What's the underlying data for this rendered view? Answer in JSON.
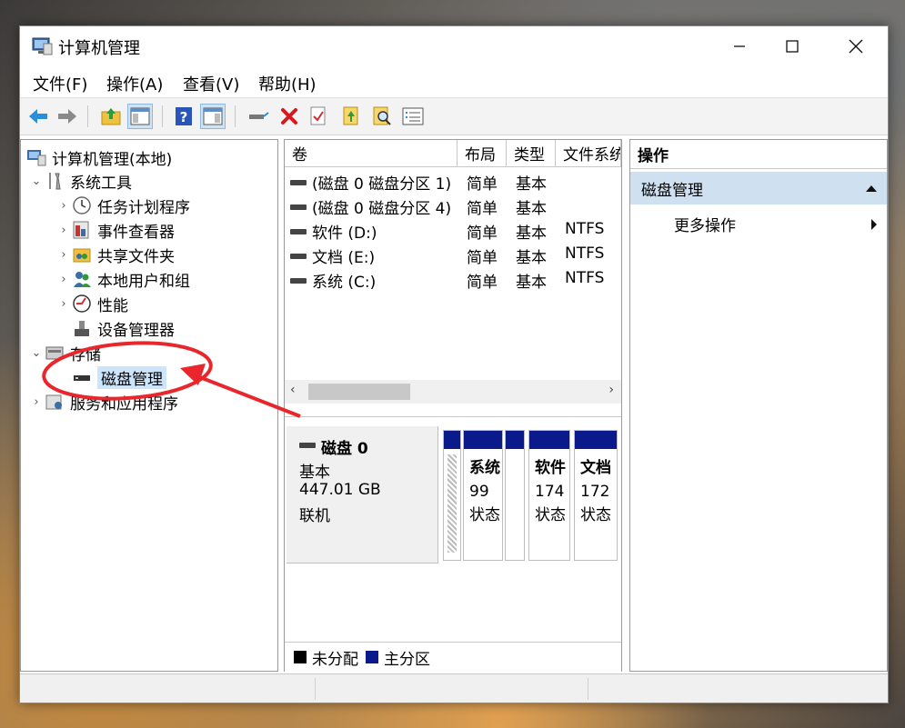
{
  "window": {
    "title": "计算机管理",
    "minimize_icon": "minimize-icon",
    "maximize_icon": "maximize-icon",
    "close_icon": "close-icon"
  },
  "menu": [
    {
      "label": "文件(F)"
    },
    {
      "label": "操作(A)"
    },
    {
      "label": "查看(V)"
    },
    {
      "label": "帮助(H)"
    }
  ],
  "toolbar": [
    "back-arrow-icon",
    "forward-arrow-icon",
    "up-folder-icon",
    "show-tree-icon",
    "help-icon",
    "action-pane-icon",
    "connect-drive-icon",
    "delete-icon",
    "check-icon",
    "import-icon",
    "search-icon",
    "properties-icon"
  ],
  "tree": {
    "root": "计算机管理(本地)",
    "system_tools": "系统工具",
    "task_scheduler": "任务计划程序",
    "event_viewer": "事件查看器",
    "shared_folders": "共享文件夹",
    "local_users": "本地用户和组",
    "performance": "性能",
    "device_manager": "设备管理器",
    "storage": "存储",
    "disk_management": "磁盘管理",
    "services_apps": "服务和应用程序"
  },
  "volume_table": {
    "headers": [
      "卷",
      "布局",
      "类型",
      "文件系统"
    ],
    "rows": [
      {
        "volume": "(磁盘 0 磁盘分区 1)",
        "layout": "简单",
        "type": "基本",
        "fs": ""
      },
      {
        "volume": "(磁盘 0 磁盘分区 4)",
        "layout": "简单",
        "type": "基本",
        "fs": ""
      },
      {
        "volume": "软件 (D:)",
        "layout": "简单",
        "type": "基本",
        "fs": "NTFS"
      },
      {
        "volume": "文档 (E:)",
        "layout": "简单",
        "type": "基本",
        "fs": "NTFS"
      },
      {
        "volume": "系统 (C:)",
        "layout": "简单",
        "type": "基本",
        "fs": "NTFS"
      }
    ]
  },
  "disk": {
    "name": "磁盘 0",
    "type": "基本",
    "size": "447.01 GB",
    "status": "联机",
    "partitions": [
      {
        "name": "系统",
        "size": "99",
        "status": "状态"
      },
      {
        "name": "软件",
        "size": "174",
        "status": "状态"
      },
      {
        "name": "文档",
        "size": "172",
        "status": "状态"
      }
    ]
  },
  "legend": {
    "unallocated": "未分配",
    "primary": "主分区"
  },
  "actions": {
    "header": "操作",
    "section": "磁盘管理",
    "more": "更多操作"
  },
  "colors": {
    "primary_partition": "#0a1a8a",
    "annotation": "#e8262b",
    "selection": "#cde5fb"
  }
}
